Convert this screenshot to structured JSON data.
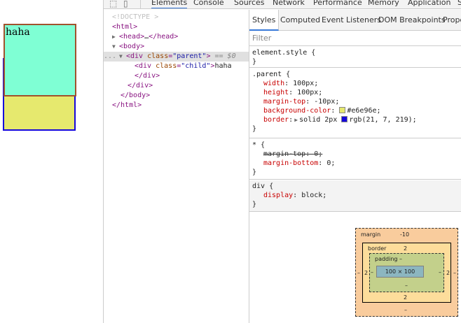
{
  "preview": {
    "child_text": "haha",
    "colors": {
      "parent_bg": "#e6e96e",
      "parent_border": "rgb(21, 7, 219)",
      "child_bg": "#7fffd4",
      "child_border": "#a0522d"
    }
  },
  "devtools": {
    "tabs": [
      {
        "label": "Elements",
        "active": true
      },
      {
        "label": "Console",
        "active": false
      },
      {
        "label": "Sources",
        "active": false
      },
      {
        "label": "Network",
        "active": false
      },
      {
        "label": "Performance",
        "active": false
      },
      {
        "label": "Memory",
        "active": false
      },
      {
        "label": "Application",
        "active": false
      },
      {
        "label": "S",
        "active": false
      }
    ],
    "dom": {
      "doctype": "<!DOCTYPE >",
      "html_open": "<html>",
      "head": "<head>",
      "head_ellipsis": "…",
      "head_close": "</head>",
      "body_open": "<body>",
      "div_open_tag": "<div",
      "attr_class": "class",
      "attr_parent_val": "\"parent\"",
      "selected_marker": "== $0",
      "dots": "...",
      "div_child_tag": "<div",
      "attr_child_val": "\"child\"",
      "child_text": "haha",
      "div_close": "</div>",
      "body_close": "</body>",
      "html_close": "</html>"
    },
    "styles": {
      "subtabs": [
        "Styles",
        "Computed",
        "Event Listeners",
        "DOM Breakpoints",
        "Prope"
      ],
      "filter_placeholder": "Filter",
      "element_style": {
        "selector": "element.style {",
        "close": "}"
      },
      "parent_rule": {
        "selector": ".parent {",
        "decls": [
          {
            "prop": "width",
            "value": "100px;"
          },
          {
            "prop": "height",
            "value": "100px;"
          },
          {
            "prop": "margin-top",
            "value": "-10px;"
          },
          {
            "prop": "background-color",
            "value": "#e6e96e;"
          },
          {
            "prop": "border",
            "value": "solid 2px",
            "value2": "rgb(21, 7, 219);"
          }
        ],
        "close": "}"
      },
      "universal_rule": {
        "selector": "* {",
        "decls": [
          {
            "prop": "margin-top",
            "value": "0;"
          },
          {
            "prop": "margin-bottom",
            "value": "0;"
          }
        ],
        "close": "}"
      },
      "div_rule": {
        "selector": "div {",
        "decls": [
          {
            "prop": "display",
            "value": "block;"
          }
        ],
        "close": "}"
      }
    },
    "boxmodel": {
      "margin_label": "margin",
      "margin_top": "-10",
      "margin_left": "–",
      "margin_right": "–",
      "margin_bottom": "–",
      "border_label": "border",
      "border_top": "2",
      "border_left": "2",
      "border_right": "2",
      "border_bottom": "2",
      "padding_label": "padding –",
      "padding_left": "–",
      "padding_right": "–",
      "padding_bottom": "–",
      "content": "100 × 100"
    }
  }
}
